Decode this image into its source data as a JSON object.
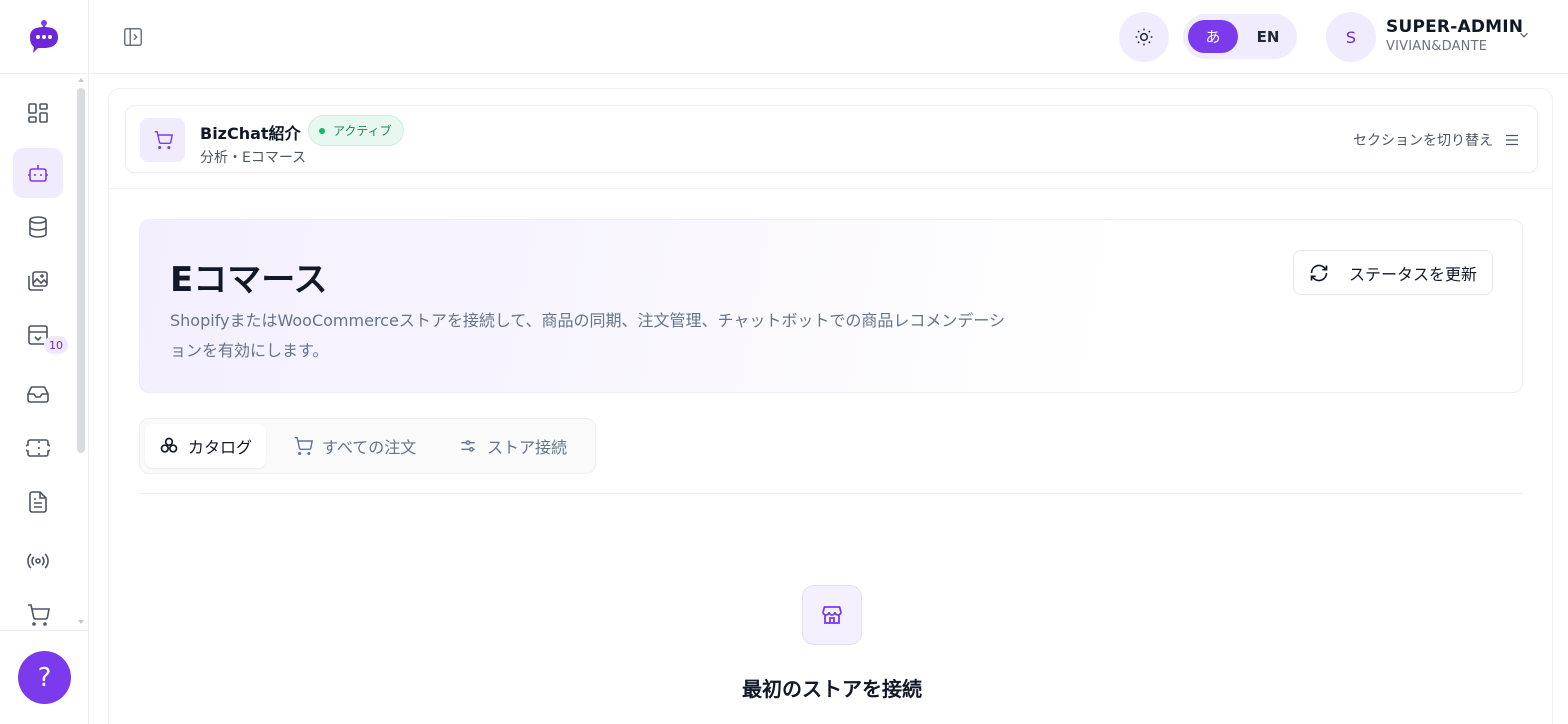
{
  "header": {
    "lang_ja": "あ",
    "lang_en": "EN",
    "user": {
      "initial": "S",
      "name": "SUPER-ADMIN",
      "org": "VIVIAN&DANTE"
    }
  },
  "sidebar": {
    "badge_count": "10",
    "help_label": "?",
    "items": [
      {
        "icon": "dashboard-icon",
        "active": false
      },
      {
        "icon": "bot-icon",
        "active": true
      },
      {
        "icon": "database-icon",
        "active": false
      },
      {
        "icon": "images-icon",
        "active": false
      },
      {
        "icon": "archive-icon",
        "active": false
      },
      {
        "icon": "inbox-icon",
        "active": false
      },
      {
        "icon": "ticket-icon",
        "active": false
      },
      {
        "icon": "document-icon",
        "active": false
      },
      {
        "icon": "broadcast-icon",
        "active": false
      },
      {
        "icon": "cart-icon",
        "active": false
      }
    ]
  },
  "section": {
    "title": "BizChat紹介",
    "status": "アクティブ",
    "subtitle": "分析・Eコマース",
    "switch_label": "セクションを切り替え"
  },
  "hero": {
    "title": "Eコマース",
    "description": "ShopifyまたはWooCommerceストアを接続して、商品の同期、注文管理、チャットボットでの商品レコメンデーションを有効にします。",
    "refresh_label": "ステータスを更新"
  },
  "tabs": [
    {
      "label": "カタログ",
      "active": true
    },
    {
      "label": "すべての注文",
      "active": false
    },
    {
      "label": "ストア接続",
      "active": false
    }
  ],
  "empty_state": {
    "title": "最初のストアを接続"
  },
  "colors": {
    "accent": "#7c3aed",
    "accent_light": "#f1ecfd",
    "success": "#14b86a"
  }
}
